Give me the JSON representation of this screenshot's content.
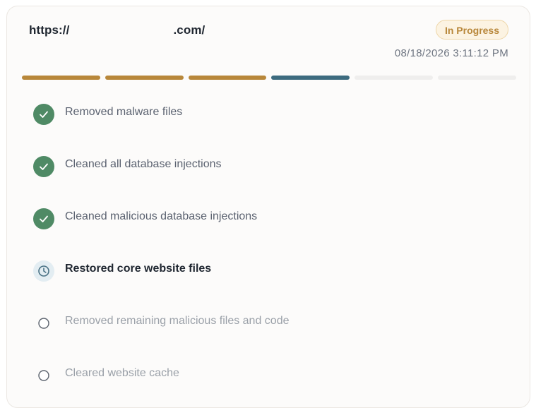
{
  "header": {
    "url_prefix": "https://",
    "url_suffix": ".com/",
    "status_badge": "In Progress",
    "timestamp": "08/18/2026 3:11:12 PM"
  },
  "progress": {
    "segments": [
      {
        "state": "completed",
        "color": "#b8873a"
      },
      {
        "state": "completed",
        "color": "#b8873a"
      },
      {
        "state": "completed",
        "color": "#b8873a"
      },
      {
        "state": "active",
        "color": "#3d6b7f"
      },
      {
        "state": "pending",
        "color": "#efeeed"
      },
      {
        "state": "pending",
        "color": "#efeeed"
      }
    ]
  },
  "steps": [
    {
      "label": "Removed malware files",
      "status": "completed",
      "icon": "check-circle-icon"
    },
    {
      "label": "Cleaned all database injections",
      "status": "completed",
      "icon": "check-circle-icon"
    },
    {
      "label": "Cleaned malicious database injections",
      "status": "completed",
      "icon": "check-circle-icon"
    },
    {
      "label": "Restored core website files",
      "status": "in-progress",
      "icon": "clock-icon"
    },
    {
      "label": "Removed remaining malicious files and code",
      "status": "pending",
      "icon": "empty-circle-icon"
    },
    {
      "label": "Cleared website cache",
      "status": "pending",
      "icon": "empty-circle-icon"
    }
  ],
  "colors": {
    "completed_icon_bg": "#4f8a65",
    "active_icon_bg": "#e3edf2",
    "active_icon_stroke": "#4a7285",
    "completed_text": "#5b6270",
    "active_text": "#1f2630",
    "pending_text": "#9aa0a8",
    "badge_text": "#b8873a"
  }
}
